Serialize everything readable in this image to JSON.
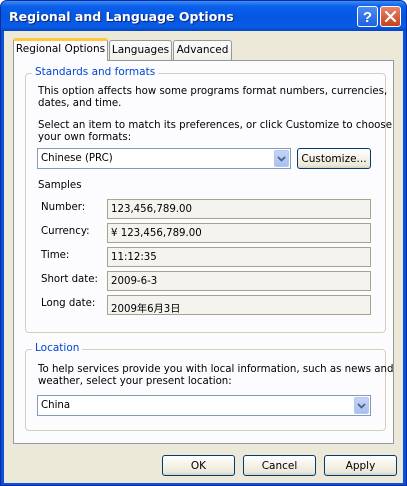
{
  "window": {
    "title": "Regional and Language Options",
    "help_icon": "help-icon",
    "close_icon": "close-icon"
  },
  "tabs": [
    {
      "label": "Regional Options",
      "active": true
    },
    {
      "label": "Languages",
      "active": false
    },
    {
      "label": "Advanced",
      "active": false
    }
  ],
  "standards": {
    "label": "Standards and formats",
    "description": [
      "This option affects how some programs format numbers, currencies,",
      "dates, and time."
    ],
    "instruction": [
      "Select an item to match its preferences, or click Customize to choose",
      "your own formats:"
    ],
    "selected_format": "Chinese (PRC)",
    "customize_label": "Customize...",
    "samples_label": "Samples",
    "samples": [
      {
        "label": "Number:",
        "value": "123,456,789.00"
      },
      {
        "label": "Currency:",
        "value": "¥ 123,456,789.00"
      },
      {
        "label": "Time:",
        "value": "11:12:35"
      },
      {
        "label": "Short date:",
        "value": "2009-6-3"
      },
      {
        "label": "Long date:",
        "value": "2009年6月3日"
      }
    ]
  },
  "location": {
    "label": "Location",
    "description": [
      "To help services provide you with local information, such as news and",
      "weather, select your present location:"
    ],
    "selected_location": "China"
  },
  "footer": {
    "ok_label": "OK",
    "cancel_label": "Cancel",
    "apply_label": "Apply"
  },
  "colors": {
    "titlebar": "#0456e2",
    "group_label": "#0046d5",
    "active_tab_accent": "#ffc83c",
    "dialog_face": "#ece9d8"
  }
}
